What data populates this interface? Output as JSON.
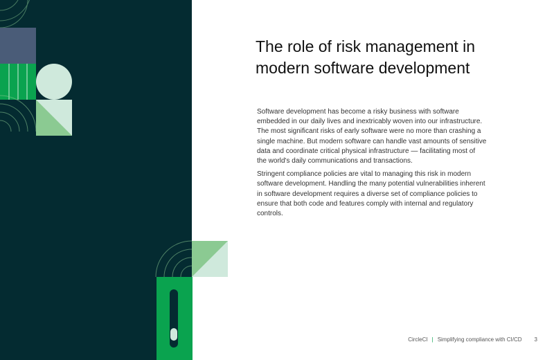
{
  "heading": {
    "line1": "The role of risk management in",
    "line2": "modern software development"
  },
  "paragraphs": [
    {
      "lines": [
        "Software development has become a risky business with software",
        "embedded in our daily lives and inextricably woven into our infrastructure.",
        "The most significant risks of early software were no more than crashing a",
        "single machine. But modern software can handle vast amounts of sensitive",
        "data and coordinate critical physical infrastructure — facilitating most of",
        "the world's daily communications and transactions."
      ]
    },
    {
      "lines": [
        "Stringent compliance policies are vital to managing this risk in modern",
        "software development. Handling the many potential vulnerabilities inherent",
        "in software development requires a diverse set of compliance policies to",
        "ensure that both code and features comply with internal and regulatory",
        "controls."
      ]
    }
  ],
  "footer": {
    "brand": "CircleCI",
    "separator": "|",
    "title": "Simplifying compliance with CI/CD",
    "page_number": "3"
  },
  "colors": {
    "panel_dark": "#042b31",
    "green": "#0aa34f",
    "mint": "#cfe9dc",
    "slate": "#4a5c78",
    "light_green": "#8bca92"
  }
}
